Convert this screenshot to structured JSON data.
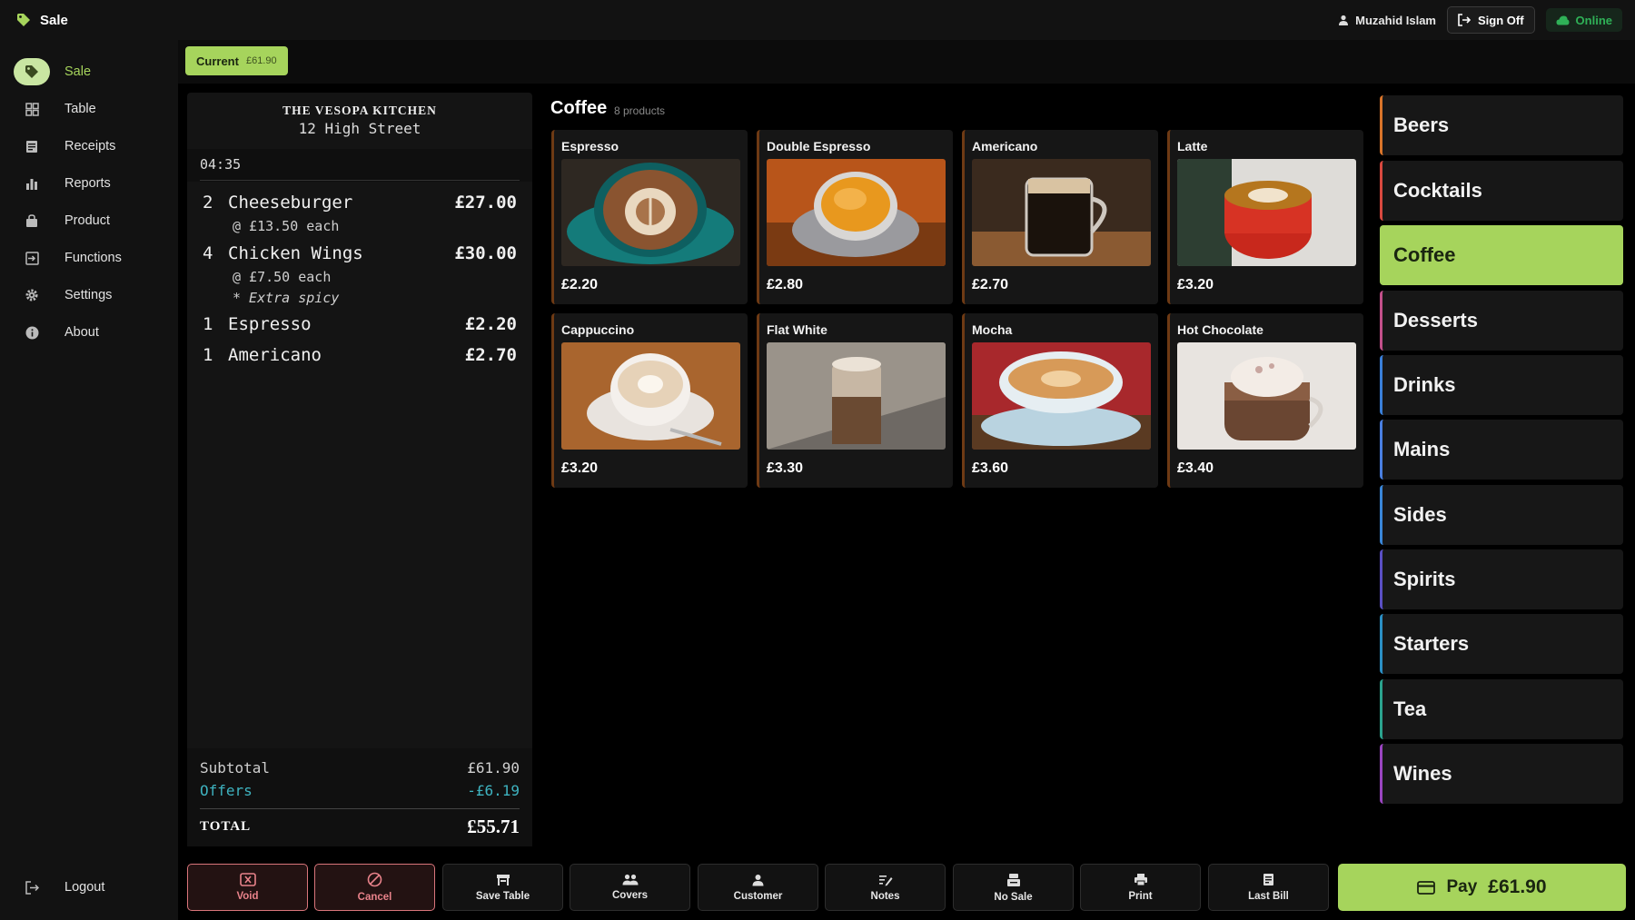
{
  "header": {
    "title": "Sale",
    "user_name": "Muzahid Islam",
    "sign_off_label": "Sign Off",
    "status_label": "Online",
    "status_color": "#2fb157"
  },
  "sidebar": {
    "items": [
      {
        "label": "Sale",
        "icon": "tag-icon",
        "active": true
      },
      {
        "label": "Table",
        "icon": "grid-icon"
      },
      {
        "label": "Receipts",
        "icon": "receipt-icon"
      },
      {
        "label": "Reports",
        "icon": "bar-chart-icon"
      },
      {
        "label": "Product",
        "icon": "bag-icon"
      },
      {
        "label": "Functions",
        "icon": "login-box-icon"
      },
      {
        "label": "Settings",
        "icon": "gear-icon"
      },
      {
        "label": "About",
        "icon": "info-icon"
      }
    ],
    "logout_label": "Logout"
  },
  "order_tab": {
    "label": "Current",
    "amount": "£61.90"
  },
  "receipt": {
    "store_name": "THE VESOPA KITCHEN",
    "address": "12 High Street",
    "time": "04:35",
    "items": [
      {
        "qty": "2",
        "name": "Cheeseburger",
        "price": "£27.00",
        "each": "@ £13.50 each"
      },
      {
        "qty": "4",
        "name": "Chicken Wings",
        "price": "£30.00",
        "each": "@ £7.50 each",
        "note": "* Extra spicy"
      },
      {
        "qty": "1",
        "name": "Espresso",
        "price": "£2.20"
      },
      {
        "qty": "1",
        "name": "Americano",
        "price": "£2.70"
      }
    ],
    "subtotal_label": "Subtotal",
    "subtotal": "£61.90",
    "offers_label": "Offers",
    "offers": "-£6.19",
    "total_label": "TOTAL",
    "total": "£55.71"
  },
  "category_header": {
    "title": "Coffee",
    "count": "8 products"
  },
  "products": [
    {
      "name": "Espresso",
      "price": "£2.20"
    },
    {
      "name": "Double Espresso",
      "price": "£2.80"
    },
    {
      "name": "Americano",
      "price": "£2.70"
    },
    {
      "name": "Latte",
      "price": "£3.20"
    },
    {
      "name": "Cappuccino",
      "price": "£3.20"
    },
    {
      "name": "Flat White",
      "price": "£3.30"
    },
    {
      "name": "Mocha",
      "price": "£3.60"
    },
    {
      "name": "Hot Chocolate",
      "price": "£3.40"
    }
  ],
  "categories": [
    {
      "label": "Beers",
      "color": "#d9742a"
    },
    {
      "label": "Cocktails",
      "color": "#d8493f"
    },
    {
      "label": "Coffee",
      "color": "#a6d45c",
      "active": true
    },
    {
      "label": "Desserts",
      "color": "#c24f8a"
    },
    {
      "label": "Drinks",
      "color": "#3a7fd8"
    },
    {
      "label": "Mains",
      "color": "#4a7fe0"
    },
    {
      "label": "Sides",
      "color": "#3a86d8"
    },
    {
      "label": "Spirits",
      "color": "#5b4fc4"
    },
    {
      "label": "Starters",
      "color": "#2b8fc4"
    },
    {
      "label": "Tea",
      "color": "#2ba38e"
    },
    {
      "label": "Wines",
      "color": "#9a45c0"
    }
  ],
  "actions": {
    "void": "Void",
    "cancel": "Cancel",
    "save_table": "Save Table",
    "covers": "Covers",
    "customer": "Customer",
    "notes": "Notes",
    "no_sale": "No Sale",
    "print": "Print",
    "last_bill": "Last Bill",
    "pay_label": "Pay",
    "pay_amount": "£61.90"
  },
  "theme": {
    "accent": "#a6d45c",
    "danger": "#e8828a",
    "offers": "#3eb3c0"
  }
}
